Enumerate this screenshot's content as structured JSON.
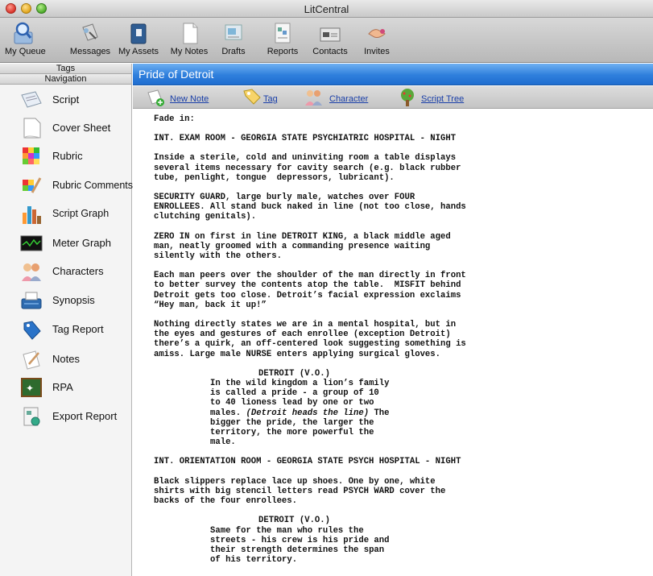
{
  "window": {
    "title": "LitCentral"
  },
  "toolbar": {
    "items": [
      {
        "label": "My Queue"
      },
      {
        "label": "Messages"
      },
      {
        "label": "My Assets"
      },
      {
        "label": "My Notes"
      },
      {
        "label": "Drafts"
      },
      {
        "label": "Reports"
      },
      {
        "label": "Contacts"
      },
      {
        "label": "Invites"
      }
    ]
  },
  "sidebar": {
    "header_tags": "Tags",
    "header_nav": "Navigation",
    "items": [
      {
        "label": "Script",
        "icon": "script-icon"
      },
      {
        "label": "Cover Sheet",
        "icon": "cover-sheet-icon"
      },
      {
        "label": "Rubric",
        "icon": "rubric-icon"
      },
      {
        "label": "Rubric Comments",
        "icon": "rubric-comments-icon"
      },
      {
        "label": "Script Graph",
        "icon": "script-graph-icon"
      },
      {
        "label": "Meter Graph",
        "icon": "meter-graph-icon"
      },
      {
        "label": "Characters",
        "icon": "characters-icon"
      },
      {
        "label": "Synopsis",
        "icon": "synopsis-icon"
      },
      {
        "label": "Tag Report",
        "icon": "tag-report-icon"
      },
      {
        "label": "Notes",
        "icon": "notes-icon"
      },
      {
        "label": "RPA",
        "icon": "rpa-icon"
      },
      {
        "label": "Export Report",
        "icon": "export-report-icon"
      }
    ]
  },
  "panel": {
    "title": "Pride of Detroit",
    "actions": [
      {
        "label": "New Note",
        "icon": "new-note-icon"
      },
      {
        "label": "Tag",
        "icon": "tag-icon"
      },
      {
        "label": "Character",
        "icon": "character-icon"
      },
      {
        "label": "Script Tree",
        "icon": "script-tree-icon"
      }
    ]
  },
  "script": {
    "p1": "Fade in:",
    "p2": "INT. EXAM ROOM - GEORGIA STATE PSYCHIATRIC HOSPITAL - NIGHT",
    "p3": "Inside a sterile, cold and uninviting room a table displays\nseveral items necessary for cavity search (e.g. black rubber\ntube, penlight, tongue  depressors, lubricant).",
    "p4": "SECURITY GUARD, large burly male, watches over FOUR\nENROLLEES. All stand buck naked in line (not too close, hands\nclutching genitals).",
    "p5": "ZERO IN on first in line DETROIT KING, a black middle aged\nman, neatly groomed with a commanding presence waiting\nsilently with the others.",
    "p6": "Each man peers over the shoulder of the man directly in front\nto better survey the contents atop the table.  MISFIT behind\nDetroit gets too close. Detroit’s facial expression exclaims\n“Hey man, back it up!”",
    "p7": "Nothing directly states we are in a mental hospital, but in\nthe eyes and gestures of each enrollee (exception Detroit)\nthere’s a quirk, an off-centered look suggesting something is\namiss. Large male NURSE enters applying surgical gloves.",
    "d1_char": "DETROIT (V.O.)",
    "d1_l1": "In the wild kingdom a lion’s family",
    "d1_l2": "is called a pride - a group of 10",
    "d1_l3": "to 40 lioness lead by one or two",
    "d1_l4a": "males. ",
    "d1_l4b": "(Detroit heads the line)",
    "d1_l4c": " The",
    "d1_l5": "bigger the pride, the larger the",
    "d1_l6": "territory, the more powerful the",
    "d1_l7": "male.",
    "p8": "INT. ORIENTATION ROOM - GEORGIA STATE PSYCH HOSPITAL - NIGHT",
    "p9": "Black slippers replace lace up shoes. One by one, white\nshirts with big stencil letters read PSYCH WARD cover the\nbacks of the four enrollees.",
    "d2_char": "DETROIT (V.O.)",
    "d2_l1": "Same for the man who rules the",
    "d2_l2": "streets - his crew is his pride and",
    "d2_l3": "their strength determines the span",
    "d2_l4": "of his territory."
  }
}
